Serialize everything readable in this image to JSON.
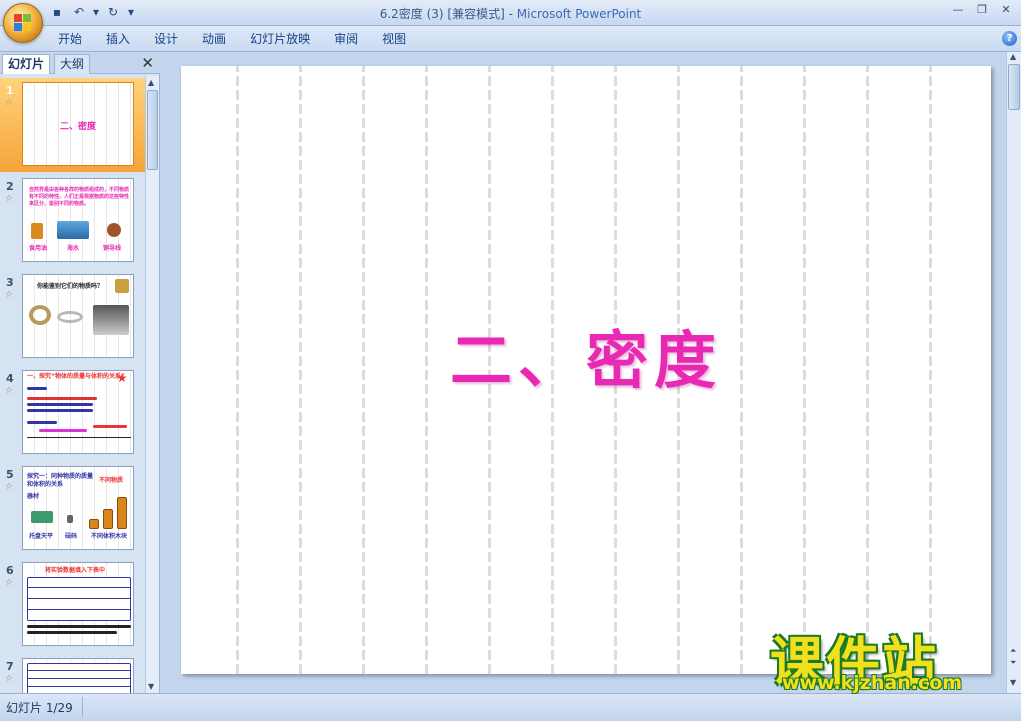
{
  "window": {
    "title_doc": "6.2密度 (3) [兼容模式] - ",
    "title_app": "Microsoft PowerPoint"
  },
  "ribbon": {
    "tabs": [
      "开始",
      "插入",
      "设计",
      "动画",
      "幻灯片放映",
      "审阅",
      "视图"
    ]
  },
  "panel": {
    "tab_slides": "幻灯片",
    "tab_outline": "大纲",
    "slides": [
      {
        "number": "1",
        "title": "二、密度"
      },
      {
        "number": "2",
        "text": "自然界是由各种各样的物质组成的，不同物质有不同的特性，人们正是根据物质的这些特性来区分、鉴别不同的物质。",
        "labels": [
          "食用油",
          "海水",
          "铜导线"
        ]
      },
      {
        "number": "3",
        "text": "你能鉴别它们的物质吗？"
      },
      {
        "number": "4",
        "heading": "一、探究“物体的质量与体积的关系”"
      },
      {
        "number": "5",
        "heading": "探究一：同种物质的质量和体积的关系",
        "note": "不同物质",
        "label": "器材",
        "labels": [
          "托盘天平",
          "砝码",
          "不同体积木块"
        ]
      },
      {
        "number": "6",
        "heading": "将实验数据填入下表中"
      },
      {
        "number": "7"
      }
    ]
  },
  "slide": {
    "title": "二、密度"
  },
  "watermark": {
    "cn": "课件站",
    "url": "www.kjzhan.com"
  },
  "status": {
    "slide_counter": "幻灯片 1/29"
  },
  "colors": {
    "title_pink": "#e928b4",
    "selection_orange": "#f6a43a",
    "ribbon_blue": "#c9daf1"
  }
}
